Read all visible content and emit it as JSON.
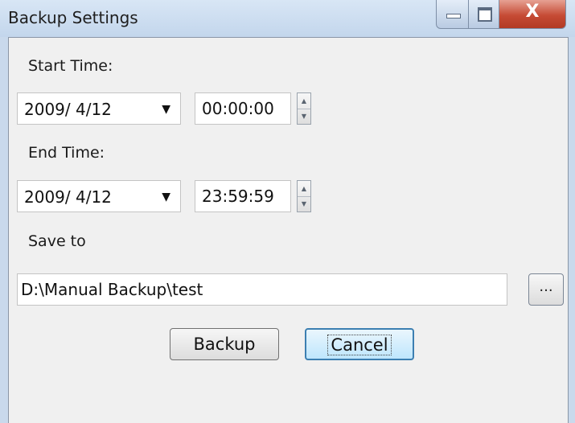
{
  "window": {
    "title": "Backup Settings",
    "controls": {
      "minimize": "minimize",
      "maximize": "maximize",
      "close": "X"
    }
  },
  "start": {
    "label": "Start Time:",
    "date": "2009/  4/12",
    "time": "00:00:00"
  },
  "end": {
    "label": "End Time:",
    "date": "2009/  4/12",
    "time": "23:59:59"
  },
  "save": {
    "label": "Save to",
    "path": "D:\\Manual Backup\\test",
    "browse_label": "..."
  },
  "buttons": {
    "backup": "Backup",
    "cancel": "Cancel"
  },
  "icons": {
    "dropdown": "chevron-down-icon",
    "spin_up": "up-arrow-icon",
    "spin_down": "down-arrow-icon"
  },
  "colors": {
    "titlebar": "#c9d9ec",
    "close": "#c64b35",
    "default_button": "#bee6fd"
  }
}
